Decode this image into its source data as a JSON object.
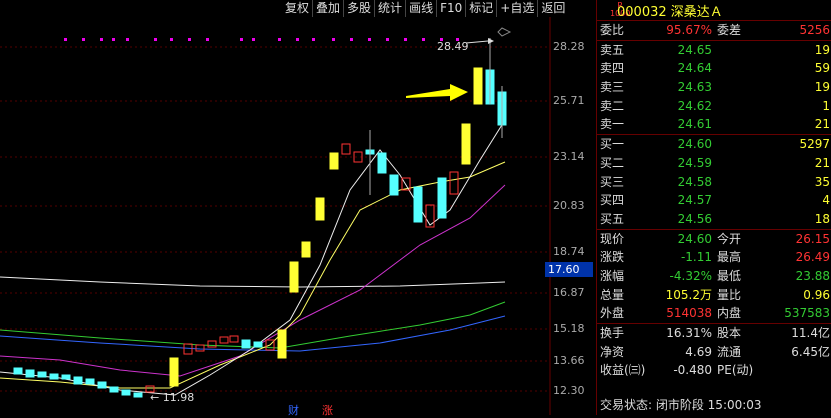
{
  "toolbar": [
    "复权",
    "叠加",
    "多股",
    "统计",
    "画线",
    "F10",
    "标记",
    "+自选",
    "返回"
  ],
  "axis_labels": [
    "28.28",
    "25.71",
    "23.14",
    "20.83",
    "18.74",
    "16.87",
    "15.18",
    "13.66",
    "12.30"
  ],
  "current_price_tag": "17.60",
  "annotations": {
    "high": "28.49",
    "low": "11.98",
    "cai": "财",
    "zhang": "涨"
  },
  "header": {
    "r": "R",
    "level": "1000",
    "code": "000032",
    "name": "深桑达Ａ"
  },
  "weibi": {
    "label": "委比",
    "value": "95.67%",
    "label2": "委差",
    "value2": "5256"
  },
  "sell": [
    {
      "label": "卖五",
      "price": "24.65",
      "vol": "19"
    },
    {
      "label": "卖四",
      "price": "24.64",
      "vol": "59"
    },
    {
      "label": "卖三",
      "price": "24.63",
      "vol": "19"
    },
    {
      "label": "卖二",
      "price": "24.62",
      "vol": "1"
    },
    {
      "label": "卖一",
      "price": "24.61",
      "vol": "21"
    }
  ],
  "buy": [
    {
      "label": "买一",
      "price": "24.60",
      "vol": "5297"
    },
    {
      "label": "买二",
      "price": "24.59",
      "vol": "21"
    },
    {
      "label": "买三",
      "price": "24.58",
      "vol": "35"
    },
    {
      "label": "买四",
      "price": "24.57",
      "vol": "4"
    },
    {
      "label": "买五",
      "price": "24.56",
      "vol": "18"
    }
  ],
  "quote": [
    {
      "l1": "现价",
      "v1": "24.60",
      "l2": "今开",
      "v2": "26.15",
      "c1": "green",
      "c2": "red"
    },
    {
      "l1": "涨跌",
      "v1": "-1.11",
      "l2": "最高",
      "v2": "26.49",
      "c1": "green",
      "c2": "red"
    },
    {
      "l1": "涨幅",
      "v1": "-4.32%",
      "l2": "最低",
      "v2": "23.88",
      "c1": "green",
      "c2": "green"
    },
    {
      "l1": "总量",
      "v1": "105.2万",
      "l2": "量比",
      "v2": "0.96",
      "c1": "yellow",
      "c2": "yellow"
    },
    {
      "l1": "外盘",
      "v1": "514038",
      "l2": "内盘",
      "v2": "537583",
      "c1": "red",
      "c2": "green"
    }
  ],
  "stats": [
    {
      "l1": "换手",
      "v1": "16.31%",
      "l2": "股本",
      "v2": "11.4亿"
    },
    {
      "l1": "净资",
      "v1": "4.69",
      "l2": "流通",
      "v2": "6.45亿"
    },
    {
      "l1": "收益(㈢)",
      "v1": "-0.480",
      "l2": "PE(动)",
      "v2": ""
    }
  ],
  "status": "交易状态: 闭市阶段 15:00:03"
}
